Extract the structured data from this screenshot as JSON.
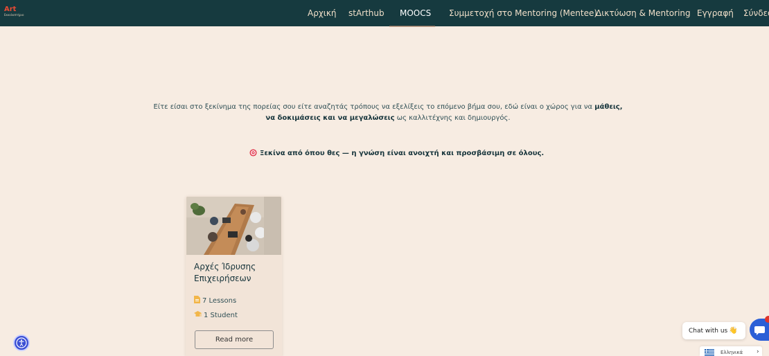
{
  "brand": {
    "logo_main": "Art",
    "logo_sub": "Εκκολαπτήριο"
  },
  "nav": {
    "items": [
      {
        "label": "Αρχική"
      },
      {
        "label": "stArthub"
      },
      {
        "label": "MOOCS"
      },
      {
        "label": "Συμμετοχή στο Mentoring (Mentee)"
      },
      {
        "label": "Δικτύωση & Mentoring"
      },
      {
        "label": "Εγγραφή"
      },
      {
        "label": "Σύνδεση"
      }
    ],
    "active_index": 2
  },
  "intro": {
    "part1": "Είτε είσαι στο ξεκίνημα της πορείας σου είτε αναζητάς τρόπους να εξελίξεις το επόμενο βήμα σου, εδώ είναι ο χώρος για να ",
    "bold1": "μάθεις, να δοκιμάσεις και να μεγαλώσεις",
    "part2": " ως καλλιτέχνης και δημιουργός."
  },
  "tagline": {
    "icon": "target-icon",
    "text": "Ξεκίνα από όπου θες — η γνώση είναι ανοιχτή και προσβάσιμη σε όλους."
  },
  "course_card": {
    "title": "Αρχές Ίδρυσης Επιχειρήσεων",
    "lessons": "7 Lessons",
    "students": "1 Student",
    "button_label": "Read more",
    "image_icon": "team-meeting-photo"
  },
  "chat": {
    "label": "Chat with us",
    "emoji": "👋",
    "icon": "chat-icon"
  },
  "language": {
    "label": "Ελληνικά",
    "flag_icon": "greek-flag-icon"
  },
  "accessibility": {
    "icon": "accessibility-icon"
  },
  "colors": {
    "nav_bg": "#163a3f",
    "page_bg": "#f7ece2",
    "accent": "#e94b34",
    "chat_blue": "#2b5fd6"
  }
}
